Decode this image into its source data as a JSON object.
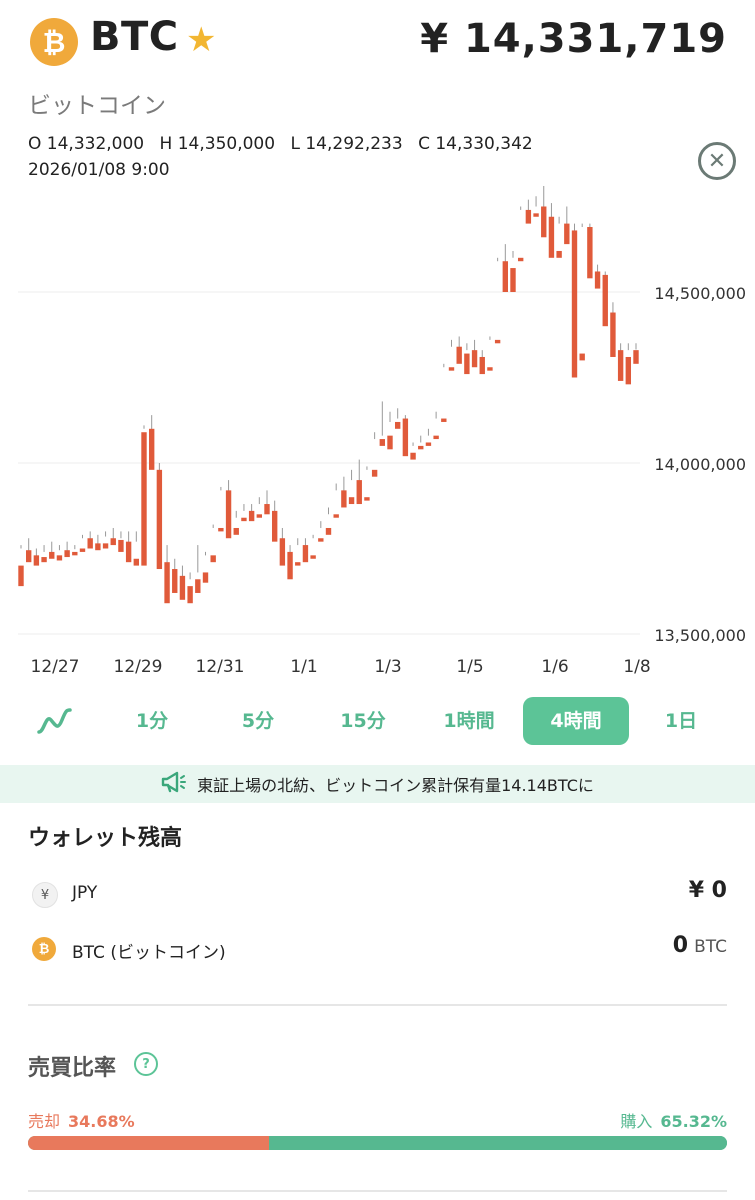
{
  "header": {
    "symbol": "BTC",
    "price": "¥ 14,331,719",
    "coin_name": "ビットコイン",
    "coin_glyph": "₿",
    "star_glyph": "★",
    "close_glyph": "✕"
  },
  "ohlc": {
    "open": "O 14,332,000",
    "high": "H 14,350,000",
    "low": "L 14,292,233",
    "close": "C 14,330,342",
    "datetime": "2026/01/08 9:00"
  },
  "chart_data": {
    "type": "candlestick",
    "y_ticks": [
      "14,500,000",
      "14,000,000",
      "13,500,000"
    ],
    "y_tick_values": [
      14500000,
      14000000,
      13500000
    ],
    "x_ticks": [
      "12/27",
      "12/29",
      "12/31",
      "1/1",
      "1/3",
      "1/5",
      "1/6",
      "1/8"
    ],
    "ylim": [
      13500000,
      14500000
    ],
    "up_color": "#5cc497",
    "down_color": "#e05a3a",
    "candles": [
      [
        13700000,
        13760000,
        13750000,
        13640000
      ],
      [
        13745000,
        13780000,
        13730000,
        13710000
      ],
      [
        13730000,
        13750000,
        13720000,
        13700000
      ],
      [
        13725000,
        13760000,
        13740000,
        13710000
      ],
      [
        13740000,
        13770000,
        13735000,
        13720000
      ],
      [
        13730000,
        13760000,
        13745000,
        13715000
      ],
      [
        13745000,
        13770000,
        13740000,
        13725000
      ],
      [
        13740000,
        13760000,
        13748000,
        13730000
      ],
      [
        13750000,
        13790000,
        13780000,
        13740000
      ],
      [
        13780000,
        13800000,
        13770000,
        13750000
      ],
      [
        13765000,
        13790000,
        13760000,
        13745000
      ],
      [
        13765000,
        13800000,
        13785000,
        13750000
      ],
      [
        13780000,
        13810000,
        13775000,
        13760000
      ],
      [
        13775000,
        13800000,
        13780000,
        13740000
      ],
      [
        13770000,
        13800000,
        13720000,
        13710000
      ],
      [
        13720000,
        13800000,
        13770000,
        13700000
      ],
      [
        14090000,
        14110000,
        14100000,
        13700000
      ],
      [
        14100000,
        14140000,
        14000000,
        13980000
      ],
      [
        13980000,
        14000000,
        13710000,
        13690000
      ],
      [
        13710000,
        13760000,
        13690000,
        13590000
      ],
      [
        13690000,
        13720000,
        13660000,
        13620000
      ],
      [
        13670000,
        13700000,
        13640000,
        13600000
      ],
      [
        13640000,
        13680000,
        13660000,
        13590000
      ],
      [
        13660000,
        13760000,
        13680000,
        13620000
      ],
      [
        13680000,
        13740000,
        13730000,
        13650000
      ],
      [
        13730000,
        13820000,
        13810000,
        13710000
      ],
      [
        13810000,
        13930000,
        13920000,
        13800000
      ],
      [
        13920000,
        13950000,
        13810000,
        13780000
      ],
      [
        13810000,
        13860000,
        13840000,
        13790000
      ],
      [
        13840000,
        13880000,
        13860000,
        13830000
      ],
      [
        13860000,
        13880000,
        13850000,
        13830000
      ],
      [
        13850000,
        13900000,
        13880000,
        13840000
      ],
      [
        13880000,
        13920000,
        13860000,
        13850000
      ],
      [
        13860000,
        13890000,
        13780000,
        13770000
      ],
      [
        13780000,
        13810000,
        13740000,
        13700000
      ],
      [
        13740000,
        13760000,
        13710000,
        13660000
      ],
      [
        13710000,
        13780000,
        13760000,
        13700000
      ],
      [
        13760000,
        13780000,
        13730000,
        13710000
      ],
      [
        13730000,
        13790000,
        13780000,
        13720000
      ],
      [
        13780000,
        13830000,
        13810000,
        13770000
      ],
      [
        13810000,
        13870000,
        13850000,
        13790000
      ],
      [
        13850000,
        13940000,
        13920000,
        13840000
      ],
      [
        13920000,
        13960000,
        13900000,
        13870000
      ],
      [
        13900000,
        13980000,
        13950000,
        13880000
      ],
      [
        13950000,
        14010000,
        13900000,
        13880000
      ],
      [
        13900000,
        13990000,
        13980000,
        13890000
      ],
      [
        13980000,
        14090000,
        14070000,
        13960000
      ],
      [
        14070000,
        14180000,
        14080000,
        14050000
      ],
      [
        14080000,
        14150000,
        14120000,
        14040000
      ],
      [
        14120000,
        14160000,
        14130000,
        14100000
      ],
      [
        14130000,
        14140000,
        14030000,
        14020000
      ],
      [
        14030000,
        14060000,
        14050000,
        14010000
      ],
      [
        14050000,
        14080000,
        14060000,
        14040000
      ],
      [
        14060000,
        14100000,
        14080000,
        14050000
      ],
      [
        14080000,
        14150000,
        14130000,
        14070000
      ],
      [
        14130000,
        14290000,
        14280000,
        14120000
      ],
      [
        14280000,
        14360000,
        14340000,
        14270000
      ],
      [
        14340000,
        14370000,
        14320000,
        14290000
      ],
      [
        14320000,
        14350000,
        14330000,
        14260000
      ],
      [
        14330000,
        14360000,
        14310000,
        14280000
      ],
      [
        14310000,
        14330000,
        14280000,
        14260000
      ],
      [
        14280000,
        14370000,
        14360000,
        14270000
      ],
      [
        14360000,
        14600000,
        14590000,
        14350000
      ],
      [
        14590000,
        14640000,
        14570000,
        14500000
      ],
      [
        14570000,
        14620000,
        14600000,
        14500000
      ],
      [
        14600000,
        14750000,
        14740000,
        14590000
      ],
      [
        14740000,
        14770000,
        14730000,
        14700000
      ],
      [
        14730000,
        14780000,
        14750000,
        14720000
      ],
      [
        14750000,
        14810000,
        14720000,
        14660000
      ],
      [
        14720000,
        14760000,
        14620000,
        14600000
      ],
      [
        14620000,
        14720000,
        14700000,
        14600000
      ],
      [
        14700000,
        14750000,
        14680000,
        14640000
      ],
      [
        14680000,
        14700000,
        14320000,
        14250000
      ],
      [
        14320000,
        14700000,
        14690000,
        14300000
      ],
      [
        14690000,
        14700000,
        14560000,
        14540000
      ],
      [
        14560000,
        14580000,
        14550000,
        14510000
      ],
      [
        14550000,
        14560000,
        14440000,
        14400000
      ],
      [
        14440000,
        14470000,
        14330000,
        14310000
      ],
      [
        14330000,
        14350000,
        14310000,
        14240000
      ],
      [
        14310000,
        14350000,
        14330000,
        14230000
      ],
      [
        14330000,
        14350000,
        14332000,
        14290000
      ]
    ]
  },
  "timeframes": [
    {
      "label": "",
      "icon": "line-chart"
    },
    {
      "label": "1分"
    },
    {
      "label": "5分"
    },
    {
      "label": "15分"
    },
    {
      "label": "1時間"
    },
    {
      "label": "4時間",
      "active": true
    },
    {
      "label": "1日"
    }
  ],
  "news": {
    "text": "東証上場の北紡、ビットコイン累計保有量14.14BTCに",
    "icon": "megaphone-icon",
    "icon_glyph": "📢"
  },
  "wallet": {
    "title": "ウォレット残高",
    "rows": [
      {
        "icon_glyph": "¥",
        "label": "JPY",
        "value": "¥ 0",
        "unit": ""
      },
      {
        "icon_glyph": "₿",
        "label": "BTC (ビットコイン)",
        "value": "0",
        "unit": "BTC"
      }
    ]
  },
  "ratio": {
    "title": "売買比率",
    "help_glyph": "?",
    "sell_label": "売却",
    "sell_pct": "34.68%",
    "sell_value": 34.68,
    "buy_label": "購入",
    "buy_pct": "65.32%",
    "buy_value": 65.32,
    "sell_color": "#e8795c",
    "buy_color": "#56b890"
  }
}
